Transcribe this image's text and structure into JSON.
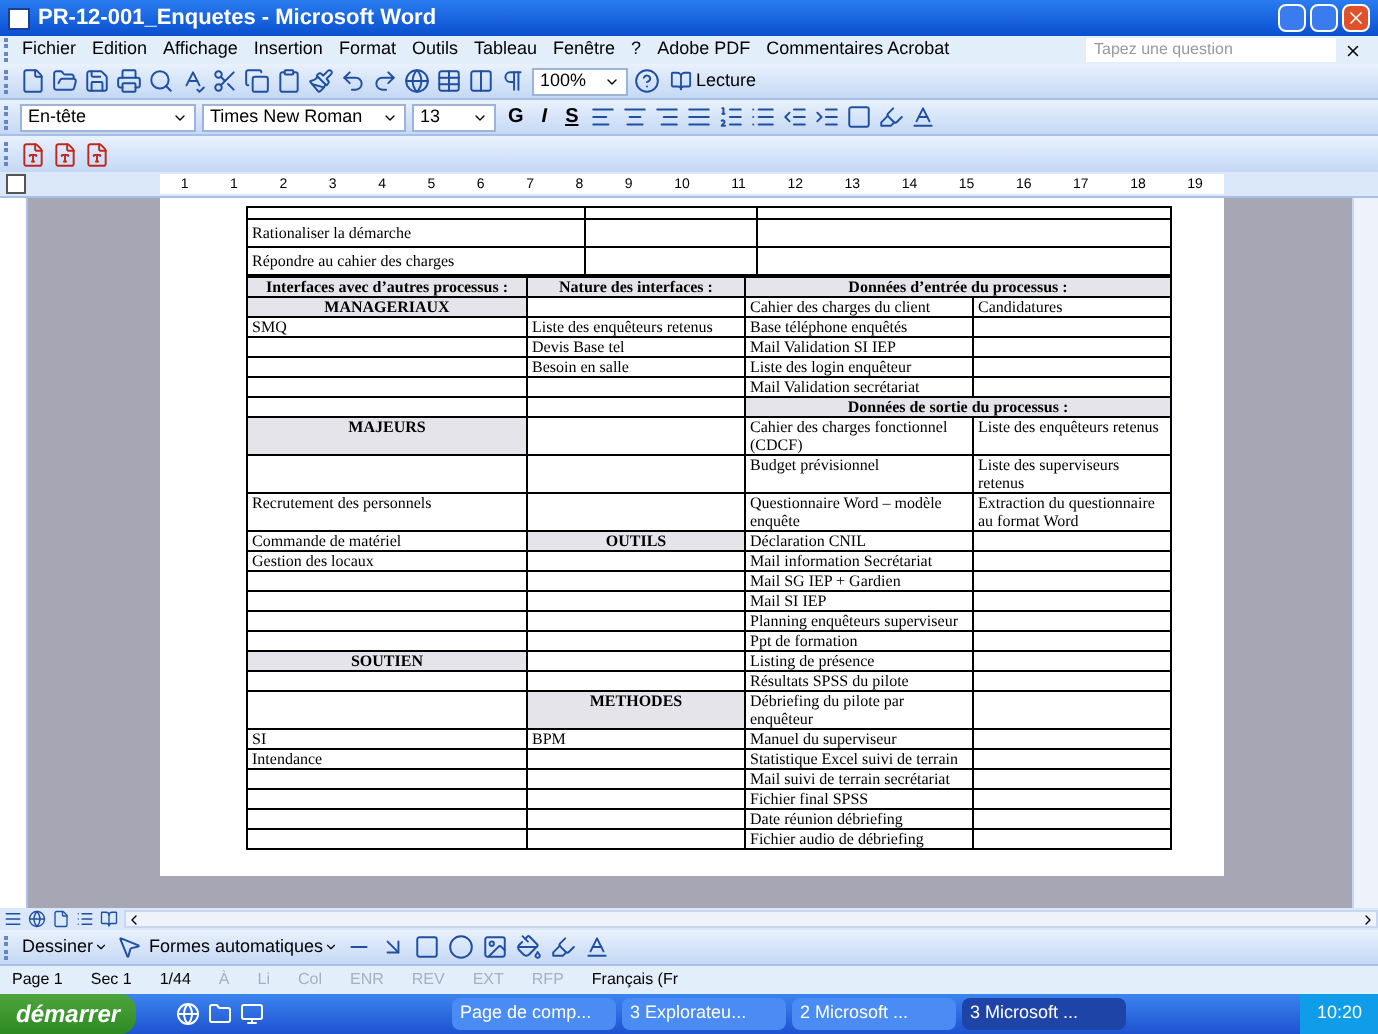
{
  "window": {
    "title": "PR-12-001_Enquetes - Microsoft Word"
  },
  "menu": [
    "Fichier",
    "Edition",
    "Affichage",
    "Insertion",
    "Format",
    "Outils",
    "Tableau",
    "Fenêtre",
    "?",
    "Adobe PDF",
    "Commentaires Acrobat"
  ],
  "help_search": {
    "placeholder": "Tapez une question"
  },
  "standard_toolbar": {
    "zoom": "100%",
    "reading_button": "Lecture"
  },
  "formatting_toolbar": {
    "style": "En-tête",
    "font": "Times New Roman",
    "size": "13",
    "bold": "G",
    "italic": "I",
    "underline": "S"
  },
  "ruler": {
    "labels": [
      "1",
      "1",
      "2",
      "3",
      "4",
      "5",
      "6",
      "7",
      "8",
      "9",
      "10",
      "11",
      "12",
      "13",
      "14",
      "15",
      "16",
      "17",
      "18",
      "19"
    ]
  },
  "top_rows": [
    "Rationaliser la démarche",
    "Répondre au cahier des charges"
  ],
  "table": {
    "rows": [
      {
        "cells": [
          {
            "kind": "heading",
            "text": "Interfaces avec d’autres processus :"
          },
          {
            "kind": "heading",
            "text": "Nature des interfaces :"
          },
          {
            "kind": "heading_wide",
            "text": "Données d’entrée du processus :",
            "colspan": 2
          }
        ]
      },
      {
        "cells": [
          {
            "kind": "category",
            "text": "MANAGERIAUX"
          },
          {
            "kind": "empty"
          },
          {
            "kind": "text",
            "text": "Cahier des charges du client"
          },
          {
            "kind": "text",
            "text": "Candidatures"
          }
        ]
      },
      {
        "cells": [
          {
            "kind": "text",
            "text": "SMQ"
          },
          {
            "kind": "text",
            "text": "Liste des enquêteurs retenus"
          },
          {
            "kind": "text",
            "text": "Base téléphone enquêtés"
          },
          {
            "kind": "empty"
          }
        ]
      },
      {
        "cells": [
          {
            "kind": "empty"
          },
          {
            "kind": "text",
            "text": "Devis Base tel"
          },
          {
            "kind": "text",
            "text": "Mail Validation SI IEP"
          },
          {
            "kind": "empty"
          }
        ]
      },
      {
        "cells": [
          {
            "kind": "empty"
          },
          {
            "kind": "text",
            "text": "Besoin en salle"
          },
          {
            "kind": "text",
            "text": "Liste des login enquêteur"
          },
          {
            "kind": "empty"
          }
        ]
      },
      {
        "cells": [
          {
            "kind": "empty"
          },
          {
            "kind": "empty"
          },
          {
            "kind": "text",
            "text": "Mail Validation secrétariat"
          },
          {
            "kind": "empty"
          }
        ]
      },
      {
        "cells": [
          {
            "kind": "empty"
          },
          {
            "kind": "empty"
          },
          {
            "kind": "heading_wide",
            "text": "Données de sortie du processus :",
            "colspan": 2
          }
        ]
      },
      {
        "cells": [
          {
            "kind": "category",
            "text": "MAJEURS"
          },
          {
            "kind": "empty"
          },
          {
            "kind": "text",
            "text": "Cahier des charges fonctionnel (CDCF)"
          },
          {
            "kind": "text",
            "text": "Liste des enquêteurs retenus"
          }
        ]
      },
      {
        "cells": [
          {
            "kind": "empty"
          },
          {
            "kind": "empty"
          },
          {
            "kind": "text",
            "text": "Budget prévisionnel"
          },
          {
            "kind": "text",
            "text": "Liste des superviseurs retenus"
          }
        ]
      },
      {
        "cells": [
          {
            "kind": "text",
            "text": "Recrutement des personnels"
          },
          {
            "kind": "empty"
          },
          {
            "kind": "text",
            "text": "Questionnaire Word – modèle enquête"
          },
          {
            "kind": "text",
            "text": "Extraction du questionnaire au format  Word"
          }
        ]
      },
      {
        "cells": [
          {
            "kind": "text",
            "text": "Commande de matériel"
          },
          {
            "kind": "category",
            "text": "OUTILS"
          },
          {
            "kind": "text",
            "text": "Déclaration CNIL"
          },
          {
            "kind": "empty"
          }
        ]
      },
      {
        "cells": [
          {
            "kind": "text",
            "text": "Gestion des locaux"
          },
          {
            "kind": "empty"
          },
          {
            "kind": "text",
            "text": "Mail information Secrétariat"
          },
          {
            "kind": "empty"
          }
        ]
      },
      {
        "cells": [
          {
            "kind": "empty"
          },
          {
            "kind": "empty"
          },
          {
            "kind": "text",
            "text": "Mail SG IEP + Gardien"
          },
          {
            "kind": "empty"
          }
        ]
      },
      {
        "cells": [
          {
            "kind": "empty"
          },
          {
            "kind": "empty"
          },
          {
            "kind": "text",
            "text": "Mail SI IEP"
          },
          {
            "kind": "empty"
          }
        ]
      },
      {
        "cells": [
          {
            "kind": "empty"
          },
          {
            "kind": "empty"
          },
          {
            "kind": "text",
            "text": "Planning enquêteurs superviseur"
          },
          {
            "kind": "empty"
          }
        ]
      },
      {
        "cells": [
          {
            "kind": "empty"
          },
          {
            "kind": "empty"
          },
          {
            "kind": "text",
            "text": "Ppt de formation"
          },
          {
            "kind": "empty"
          }
        ]
      },
      {
        "cells": [
          {
            "kind": "category",
            "text": "SOUTIEN"
          },
          {
            "kind": "empty"
          },
          {
            "kind": "text",
            "text": "Listing de présence"
          },
          {
            "kind": "empty"
          }
        ]
      },
      {
        "cells": [
          {
            "kind": "empty"
          },
          {
            "kind": "empty"
          },
          {
            "kind": "text",
            "text": "Résultats SPSS du pilote"
          },
          {
            "kind": "empty"
          }
        ]
      },
      {
        "cells": [
          {
            "kind": "empty"
          },
          {
            "kind": "category",
            "text": "METHODES"
          },
          {
            "kind": "text",
            "text": "Débriefing du pilote par enquêteur"
          },
          {
            "kind": "empty"
          }
        ]
      },
      {
        "cells": [
          {
            "kind": "text",
            "text": "SI"
          },
          {
            "kind": "text",
            "text": "BPM"
          },
          {
            "kind": "text",
            "text": "Manuel du superviseur"
          },
          {
            "kind": "empty"
          }
        ]
      },
      {
        "cells": [
          {
            "kind": "text",
            "text": "Intendance"
          },
          {
            "kind": "empty"
          },
          {
            "kind": "text",
            "text": "Statistique Excel suivi de terrain"
          },
          {
            "kind": "empty"
          }
        ]
      },
      {
        "cells": [
          {
            "kind": "empty"
          },
          {
            "kind": "empty"
          },
          {
            "kind": "text",
            "text": "Mail suivi de terrain secrétariat"
          },
          {
            "kind": "empty"
          }
        ]
      },
      {
        "cells": [
          {
            "kind": "empty"
          },
          {
            "kind": "empty"
          },
          {
            "kind": "text",
            "text": "Fichier final SPSS"
          },
          {
            "kind": "empty"
          }
        ]
      },
      {
        "cells": [
          {
            "kind": "empty"
          },
          {
            "kind": "empty"
          },
          {
            "kind": "text",
            "text": "Date réunion débriefing"
          },
          {
            "kind": "empty"
          }
        ]
      },
      {
        "cells": [
          {
            "kind": "empty"
          },
          {
            "kind": "empty"
          },
          {
            "kind": "text",
            "text": "Fichier audio de débriefing"
          },
          {
            "kind": "empty"
          }
        ]
      }
    ]
  },
  "drawing_toolbar": {
    "draw_menu": "Dessiner",
    "autoshapes_menu": "Formes automatiques"
  },
  "status_bar": [
    {
      "text": "Page 1",
      "disabled": false
    },
    {
      "text": "Sec 1",
      "disabled": false
    },
    {
      "text": "1/44",
      "disabled": false
    },
    {
      "text": "À",
      "disabled": true
    },
    {
      "text": "Li",
      "disabled": true
    },
    {
      "text": "Col",
      "disabled": true
    },
    {
      "text": "ENR",
      "disabled": true
    },
    {
      "text": "REV",
      "disabled": true
    },
    {
      "text": "EXT",
      "disabled": true
    },
    {
      "text": "RFP",
      "disabled": true
    },
    {
      "text": "Français (Fr",
      "disabled": false
    }
  ],
  "taskbar": {
    "start": "démarrer",
    "tasks": [
      {
        "label": "Page de comp...",
        "selected": false
      },
      {
        "label": "3 Explorateu...",
        "selected": false
      },
      {
        "label": "2 Microsoft ...",
        "selected": false
      },
      {
        "label": "3 Microsoft ...",
        "selected": true
      }
    ],
    "clock": "10:20"
  }
}
